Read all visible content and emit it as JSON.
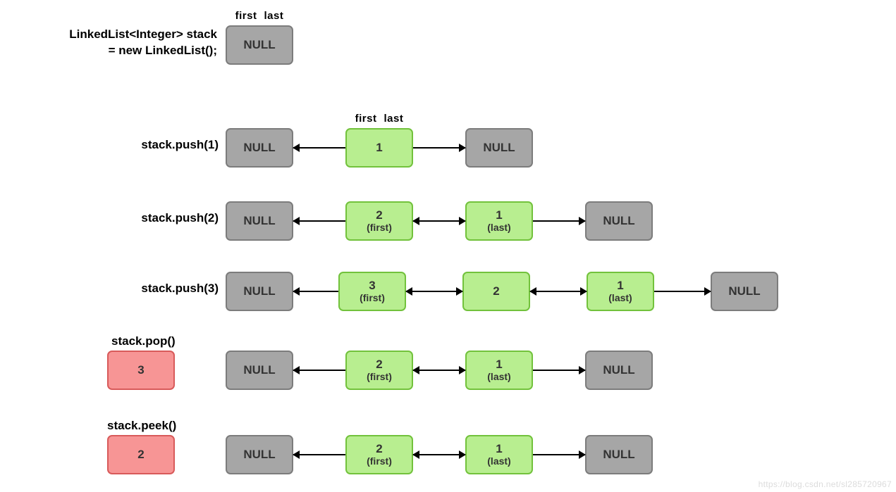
{
  "pointers": {
    "first": "first",
    "last": "last"
  },
  "nullText": "NULL",
  "declaration": "LinkedList<Integer> stack\n           = new LinkedList();",
  "rows": [
    {
      "op": "stack.push(1)"
    },
    {
      "op": "stack.push(2)"
    },
    {
      "op": "stack.push(3)"
    },
    {
      "op": "stack.pop()",
      "result": "3"
    },
    {
      "op": "stack.peek()",
      "result": "2"
    }
  ],
  "nodes": {
    "one": {
      "main": "1"
    },
    "oneLast": {
      "main": "1",
      "sub": "(last)"
    },
    "two": {
      "main": "2"
    },
    "twoFirst": {
      "main": "2",
      "sub": "(first)"
    },
    "threeFirst": {
      "main": "3",
      "sub": "(first)"
    }
  },
  "watermark": "https://blog.csdn.net/sl285720967"
}
